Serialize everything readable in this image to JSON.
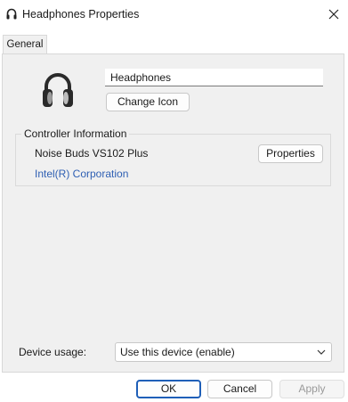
{
  "window": {
    "title": "Headphones Properties"
  },
  "tabs": [
    {
      "label": "General"
    }
  ],
  "device": {
    "name": "Headphones",
    "change_icon_label": "Change Icon"
  },
  "controller": {
    "section_label": "Controller Information",
    "name": "Noise Buds VS102 Plus",
    "properties_label": "Properties",
    "manufacturer": "Intel(R) Corporation"
  },
  "usage": {
    "label": "Device usage:",
    "selected": "Use this device (enable)"
  },
  "footer": {
    "ok_label": "OK",
    "cancel_label": "Cancel",
    "apply_label": "Apply"
  },
  "colors": {
    "accent": "#1f5fb8",
    "link": "#2e5fb3",
    "panel": "#f0f0f0"
  }
}
